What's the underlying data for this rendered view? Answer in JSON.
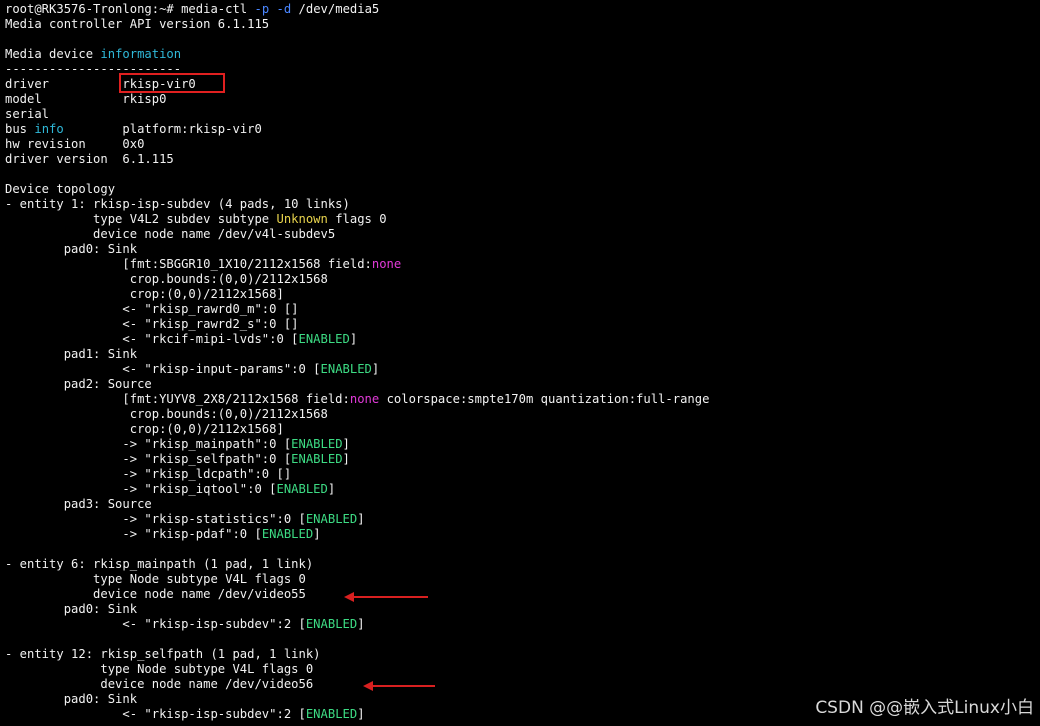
{
  "colors": {
    "background": "#000000",
    "text": "#f2f2f2",
    "cyan": "#2fb8d8",
    "yellow": "#e8d44d",
    "magenta": "#e23ad9",
    "green": "#3ddc84",
    "annotation_red": "#e02020"
  },
  "terminal": {
    "lines": [
      [
        {
          "t": "root@RK3576-Tronlong:~# media-ctl ",
          "c": "white"
        },
        {
          "t": "-p",
          "c": "blue"
        },
        {
          "t": " ",
          "c": "white"
        },
        {
          "t": "-d",
          "c": "blue"
        },
        {
          "t": " /dev/media5",
          "c": "white"
        }
      ],
      [
        {
          "t": "Media controller API version 6.1.115",
          "c": "white"
        }
      ],
      [
        {
          "t": "",
          "c": "white"
        }
      ],
      [
        {
          "t": "Media device ",
          "c": "white"
        },
        {
          "t": "information",
          "c": "cyan"
        }
      ],
      [
        {
          "t": "------------------------",
          "c": "white"
        }
      ],
      [
        {
          "t": "driver          rkisp-vir0",
          "c": "white"
        }
      ],
      [
        {
          "t": "model           rkisp0",
          "c": "white"
        }
      ],
      [
        {
          "t": "serial",
          "c": "white"
        }
      ],
      [
        {
          "t": "bus ",
          "c": "white"
        },
        {
          "t": "info",
          "c": "cyan"
        },
        {
          "t": "        platform:rkisp-vir0",
          "c": "white"
        }
      ],
      [
        {
          "t": "hw revision     0x0",
          "c": "white"
        }
      ],
      [
        {
          "t": "driver version  6.1.115",
          "c": "white"
        }
      ],
      [
        {
          "t": "",
          "c": "white"
        }
      ],
      [
        {
          "t": "Device topology",
          "c": "white"
        }
      ],
      [
        {
          "t": "- entity 1: rkisp-isp-subdev (4 pads, 10 links)",
          "c": "white"
        }
      ],
      [
        {
          "t": "            type V4L2 subdev subtype ",
          "c": "white"
        },
        {
          "t": "Unknown",
          "c": "yellow"
        },
        {
          "t": " flags 0",
          "c": "white"
        }
      ],
      [
        {
          "t": "            device node name /dev/v4l-subdev5",
          "c": "white"
        }
      ],
      [
        {
          "t": "        pad0: Sink",
          "c": "white"
        }
      ],
      [
        {
          "t": "                [fmt:SBGGR10_1X10/2112x1568 field:",
          "c": "white"
        },
        {
          "t": "none",
          "c": "magenta"
        }
      ],
      [
        {
          "t": "                 crop.bounds:(0,0)/2112x1568",
          "c": "white"
        }
      ],
      [
        {
          "t": "                 crop:(0,0)/2112x1568]",
          "c": "white"
        }
      ],
      [
        {
          "t": "                <- \"rkisp_rawrd0_m\":0 []",
          "c": "white"
        }
      ],
      [
        {
          "t": "                <- \"rkisp_rawrd2_s\":0 []",
          "c": "white"
        }
      ],
      [
        {
          "t": "                <- \"rkcif-mipi-lvds\":0 [",
          "c": "white"
        },
        {
          "t": "ENABLED",
          "c": "green"
        },
        {
          "t": "]",
          "c": "white"
        }
      ],
      [
        {
          "t": "        pad1: Sink",
          "c": "white"
        }
      ],
      [
        {
          "t": "                <- \"rkisp-input-params\":0 [",
          "c": "white"
        },
        {
          "t": "ENABLED",
          "c": "green"
        },
        {
          "t": "]",
          "c": "white"
        }
      ],
      [
        {
          "t": "        pad2: Source",
          "c": "white"
        }
      ],
      [
        {
          "t": "                [fmt:YUYV8_2X8/2112x1568 field:",
          "c": "white"
        },
        {
          "t": "none",
          "c": "magenta"
        },
        {
          "t": " colorspace:smpte170m quantization:full-range",
          "c": "white"
        }
      ],
      [
        {
          "t": "                 crop.bounds:(0,0)/2112x1568",
          "c": "white"
        }
      ],
      [
        {
          "t": "                 crop:(0,0)/2112x1568]",
          "c": "white"
        }
      ],
      [
        {
          "t": "                -> \"rkisp_mainpath\":0 [",
          "c": "white"
        },
        {
          "t": "ENABLED",
          "c": "green"
        },
        {
          "t": "]",
          "c": "white"
        }
      ],
      [
        {
          "t": "                -> \"rkisp_selfpath\":0 [",
          "c": "white"
        },
        {
          "t": "ENABLED",
          "c": "green"
        },
        {
          "t": "]",
          "c": "white"
        }
      ],
      [
        {
          "t": "                -> \"rkisp_ldcpath\":0 []",
          "c": "white"
        }
      ],
      [
        {
          "t": "                -> \"rkisp_iqtool\":0 [",
          "c": "white"
        },
        {
          "t": "ENABLED",
          "c": "green"
        },
        {
          "t": "]",
          "c": "white"
        }
      ],
      [
        {
          "t": "        pad3: Source",
          "c": "white"
        }
      ],
      [
        {
          "t": "                -> \"rkisp-statistics\":0 [",
          "c": "white"
        },
        {
          "t": "ENABLED",
          "c": "green"
        },
        {
          "t": "]",
          "c": "white"
        }
      ],
      [
        {
          "t": "                -> \"rkisp-pdaf\":0 [",
          "c": "white"
        },
        {
          "t": "ENABLED",
          "c": "green"
        },
        {
          "t": "]",
          "c": "white"
        }
      ],
      [
        {
          "t": "",
          "c": "white"
        }
      ],
      [
        {
          "t": "- entity 6: rkisp_mainpath (1 pad, 1 link)",
          "c": "white"
        }
      ],
      [
        {
          "t": "            type Node subtype V4L flags 0",
          "c": "white"
        }
      ],
      [
        {
          "t": "            device node name /dev/video55",
          "c": "white"
        }
      ],
      [
        {
          "t": "        pad0: Sink",
          "c": "white"
        }
      ],
      [
        {
          "t": "                <- \"rkisp-isp-subdev\":2 [",
          "c": "white"
        },
        {
          "t": "ENABLED",
          "c": "green"
        },
        {
          "t": "]",
          "c": "white"
        }
      ],
      [
        {
          "t": "",
          "c": "white"
        }
      ],
      [
        {
          "t": "- entity 12: rkisp_selfpath (1 pad, 1 link)",
          "c": "white"
        }
      ],
      [
        {
          "t": "             type Node subtype V4L flags 0",
          "c": "white"
        }
      ],
      [
        {
          "t": "             device node name /dev/video56",
          "c": "white"
        }
      ],
      [
        {
          "t": "        pad0: Sink",
          "c": "white"
        }
      ],
      [
        {
          "t": "                <- \"rkisp-isp-subdev\":2 [",
          "c": "white"
        },
        {
          "t": "ENABLED",
          "c": "green"
        },
        {
          "t": "]",
          "c": "white"
        }
      ]
    ]
  },
  "watermark": {
    "text": "CSDN @@嵌入式Linux小白"
  }
}
